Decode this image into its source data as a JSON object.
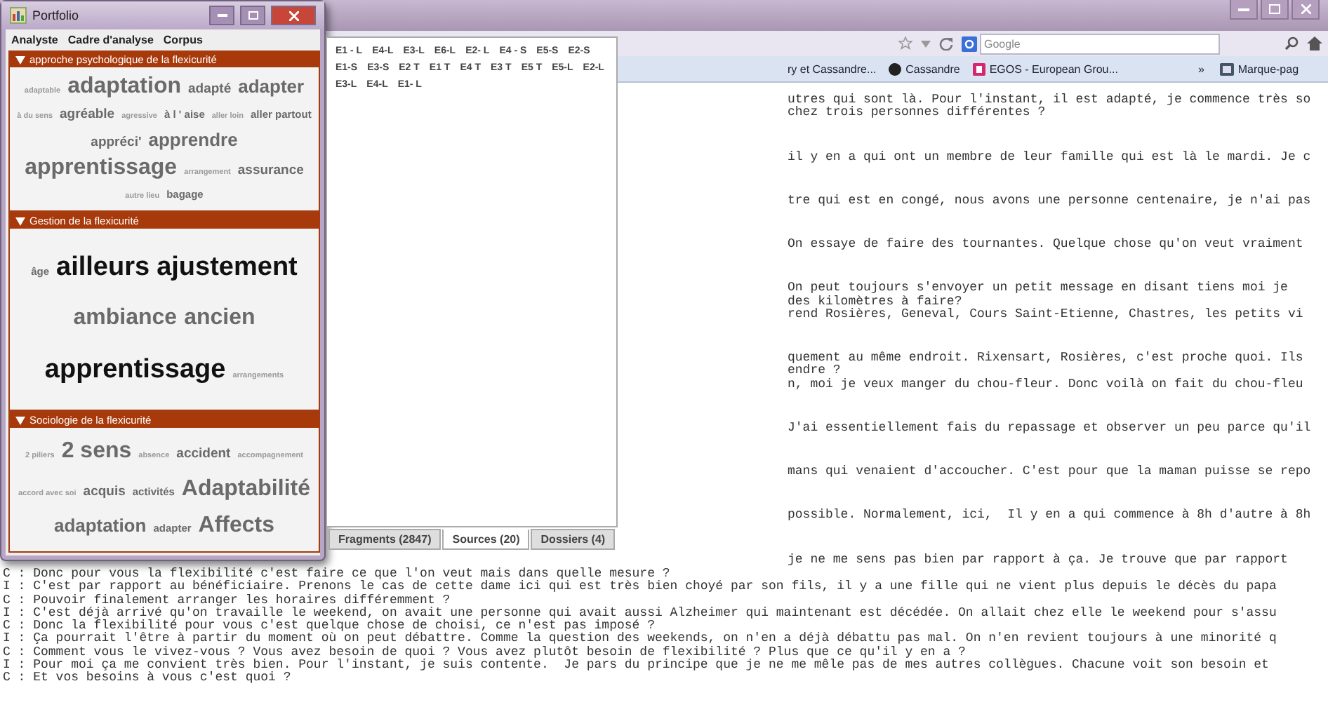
{
  "browser": {
    "search": {
      "placeholder": "Google"
    },
    "bookmarks": [
      {
        "label": "ry et Cassandre...",
        "kind": "text"
      },
      {
        "label": "Cassandre",
        "kind": "dot"
      },
      {
        "label": "EGOS - European Grou...",
        "kind": "badge"
      },
      {
        "label": "»",
        "kind": "chevron"
      },
      {
        "label": "Marque-pag",
        "kind": "folder"
      }
    ],
    "document": {
      "paragraphs": [
        {
          "lines": [
            "utres qui sont là. Pour l'instant, il est adapté, je commence très so",
            "chez trois personnes différentes ?"
          ]
        },
        {
          "lines": [
            "il y en a qui ont un membre de leur famille qui est là le mardi. Je c"
          ]
        },
        {
          "lines": [
            "tre qui est en congé, nous avons une personne centenaire, je n'ai pas"
          ]
        },
        {
          "lines": [
            "On essaye de faire des tournantes. Quelque chose qu'on veut vraiment"
          ]
        },
        {
          "lines": [
            "On peut toujours s'envoyer un petit message en disant tiens moi je",
            "des kilomètres à faire?",
            "rend Rosières, Geneval, Cours Saint-Etienne, Chastres, les petits vi"
          ]
        },
        {
          "lines": [
            "quement au même endroit. Rixensart, Rosières, c'est proche quoi. Ils",
            "endre ?",
            "n, moi je veux manger du chou-fleur. Donc voilà on fait du chou-fleu"
          ]
        },
        {
          "lines": [
            "J'ai essentiellement fais du repassage et observer un peu parce qu'il"
          ]
        },
        {
          "lines": [
            "mans qui venaient d'accoucher. C'est pour que la maman puisse se repo"
          ]
        },
        {
          "lines": [
            "possible. Normalement, ici,  Il y en a qui commence à 8h d'autre à 8h"
          ]
        },
        {
          "lines": [
            "je ne me sens pas bien par rapport à ça. Je trouve que par rapport"
          ]
        }
      ],
      "lower_lines": [
        "C : Donc pour vous la flexibilité c'est faire ce que l'on veut mais dans quelle mesure ?",
        "I : C'est par rapport au bénéficiaire. Prenons le cas de cette dame ici qui est très bien choyé par son fils, il y a une fille qui ne vient plus depuis le décès du papa",
        "C : Pouvoir finalement arranger les horaires différemment ?",
        "I : C'est déjà arrivé qu'on travaille le weekend, on avait une personne qui avait aussi Alzheimer qui maintenant est décédée. On allait chez elle le weekend pour s'assu",
        "C : Donc la flexibilité pour vous c'est quelque chose de choisi, ce n'est pas imposé ?",
        "I : Ça pourrait l'être à partir du moment où on peut débattre. Comme la question des weekends, on n'en a déjà débattu pas mal. On n'en revient toujours à une minorité q",
        "C : Comment vous le vivez-vous ? Vous avez besoin de quoi ? Vous avez plutôt besoin de flexibilité ? Plus que ce qu'il y en a ?",
        "I : Pour moi ça me convient très bien. Pour l'instant, je suis contente.  Je pars du principe que je ne me mêle pas de mes autres collègues. Chacune voit son besoin et",
        "C : Et vos besoins à vous c'est quoi ?"
      ]
    }
  },
  "portfolio": {
    "title": "Portfolio",
    "menu": [
      "Analyste",
      "Cadre d'analyse",
      "Corpus"
    ],
    "sections": [
      {
        "title": "approche psychologique de la flexicurité",
        "expanded": true,
        "words": [
          {
            "text": "adaptable",
            "kind": "xs",
            "dark": false
          },
          {
            "text": "adaptation",
            "kind": "xl",
            "dark": false
          },
          {
            "text": "adapté",
            "kind": "m",
            "dark": false
          },
          {
            "text": "adapter",
            "kind": "l",
            "dark": false
          },
          {
            "text": "à du sens",
            "kind": "xs",
            "dark": false
          },
          {
            "text": "agréable",
            "kind": "m",
            "dark": false
          },
          {
            "text": "agressive",
            "kind": "xs",
            "dark": false
          },
          {
            "text": "à l ' aise",
            "kind": "s",
            "dark": false
          },
          {
            "text": "aller loin",
            "kind": "xs",
            "dark": false
          },
          {
            "text": "aller partout",
            "kind": "s",
            "dark": false
          },
          {
            "text": "appréci'",
            "kind": "m",
            "dark": false
          },
          {
            "text": "apprendre",
            "kind": "l",
            "dark": false
          },
          {
            "text": "apprentissage",
            "kind": "xl",
            "dark": false
          },
          {
            "text": "arrangement",
            "kind": "xs",
            "dark": false
          },
          {
            "text": "assurance",
            "kind": "m",
            "dark": false
          },
          {
            "text": "autre lieu",
            "kind": "xs",
            "dark": false
          },
          {
            "text": "bagage",
            "kind": "s",
            "dark": false
          }
        ]
      },
      {
        "title": "Gestion de la flexicurité",
        "expanded": true,
        "words": [
          {
            "text": "âge",
            "kind": "s",
            "dark": false
          },
          {
            "text": "ailleurs",
            "kind": "xxl",
            "dark": true
          },
          {
            "text": "ajustement",
            "kind": "xxl",
            "dark": true
          },
          {
            "text": "ambiance",
            "kind": "xl",
            "dark": false
          },
          {
            "text": "ancien",
            "kind": "xl",
            "dark": false
          },
          {
            "text": "apprentissage",
            "kind": "xxl",
            "dark": true
          },
          {
            "text": "arrangements",
            "kind": "xs",
            "dark": false
          }
        ]
      },
      {
        "title": "Sociologie de la flexicurité",
        "expanded": true,
        "words": [
          {
            "text": "2 piliers",
            "kind": "xs",
            "dark": false
          },
          {
            "text": "2 sens",
            "kind": "xl",
            "dark": false
          },
          {
            "text": "absence",
            "kind": "xs",
            "dark": false
          },
          {
            "text": "accident",
            "kind": "m",
            "dark": false
          },
          {
            "text": "accompagnement",
            "kind": "xs",
            "dark": false
          },
          {
            "text": "accord avec soi",
            "kind": "xs",
            "dark": false
          },
          {
            "text": "acquis",
            "kind": "m",
            "dark": false
          },
          {
            "text": "activités",
            "kind": "s",
            "dark": false
          },
          {
            "text": "Adaptabilité",
            "kind": "xl",
            "dark": false
          },
          {
            "text": "adaptation",
            "kind": "l",
            "dark": false
          },
          {
            "text": "adapter",
            "kind": "s",
            "dark": false
          },
          {
            "text": "Affects",
            "kind": "xl",
            "dark": false
          }
        ]
      }
    ],
    "sources": [
      "E1 - L",
      "E4-L",
      "E3-L",
      "E6-L",
      "E2- L",
      "E4 - S",
      "E5-S",
      "E2-S",
      "E1-S",
      "E3-S",
      "E2 T",
      "E1 T",
      "E4 T",
      "E3 T",
      "E5 T",
      "E5-L",
      "E2-L",
      "E3-L",
      "E4-L",
      "E1- L"
    ],
    "tabs": [
      {
        "label": "Fragments (2847)",
        "selected": false
      },
      {
        "label": "Sources (20)",
        "selected": true
      },
      {
        "label": "Dossiers (4)",
        "selected": false
      }
    ]
  }
}
